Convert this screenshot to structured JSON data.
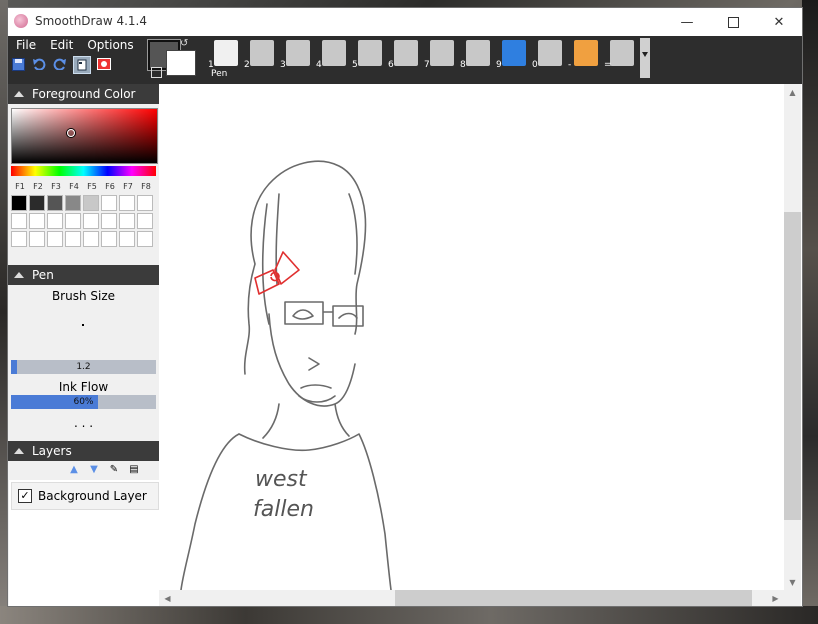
{
  "window": {
    "title": "SmoothDraw 4.1.4"
  },
  "menu": {
    "items": [
      "File",
      "Edit",
      "Options"
    ]
  },
  "tools": {
    "selected_label": "Pen",
    "items": [
      {
        "key": "1",
        "name": "pen"
      },
      {
        "key": "2",
        "name": "pencil"
      },
      {
        "key": "3",
        "name": "highlighter"
      },
      {
        "key": "4",
        "name": "brush"
      },
      {
        "key": "5",
        "name": "airbrush"
      },
      {
        "key": "6",
        "name": "spray"
      },
      {
        "key": "7",
        "name": "oil-brush"
      },
      {
        "key": "8",
        "name": "flat-brush"
      },
      {
        "key": "9",
        "name": "star-brush"
      },
      {
        "key": "0",
        "name": "water-drop"
      },
      {
        "key": "-",
        "name": "finger-smudge"
      },
      {
        "key": "=",
        "name": "eraser"
      }
    ]
  },
  "panels": {
    "foreground_color": "Foreground Color",
    "fkeys": [
      "F1",
      "F2",
      "F3",
      "F4",
      "F5",
      "F6",
      "F7",
      "F8"
    ],
    "palette_colors": [
      "#000000",
      "#2b2b2b",
      "#555555",
      "#888888",
      "#c8c8c8",
      "#ffffff",
      "#ffffff",
      "#ffffff"
    ],
    "pen": "Pen",
    "brush_size_label": "Brush Size",
    "brush_size_value": "1.2",
    "brush_size_fraction": 0.04,
    "ink_flow_label": "Ink Flow",
    "ink_flow_value": "60%",
    "ink_flow_fraction": 0.6,
    "more": ". . .",
    "layers": "Layers",
    "layer_name": "Background Layer"
  },
  "drawing": {
    "shirt_line1": "west",
    "shirt_line2": "fallen"
  },
  "colors": {
    "accent": "#4a7bd6",
    "panel_header": "#3b3b3b",
    "toolbar": "#2d2d2d",
    "bow": "#e03030"
  }
}
